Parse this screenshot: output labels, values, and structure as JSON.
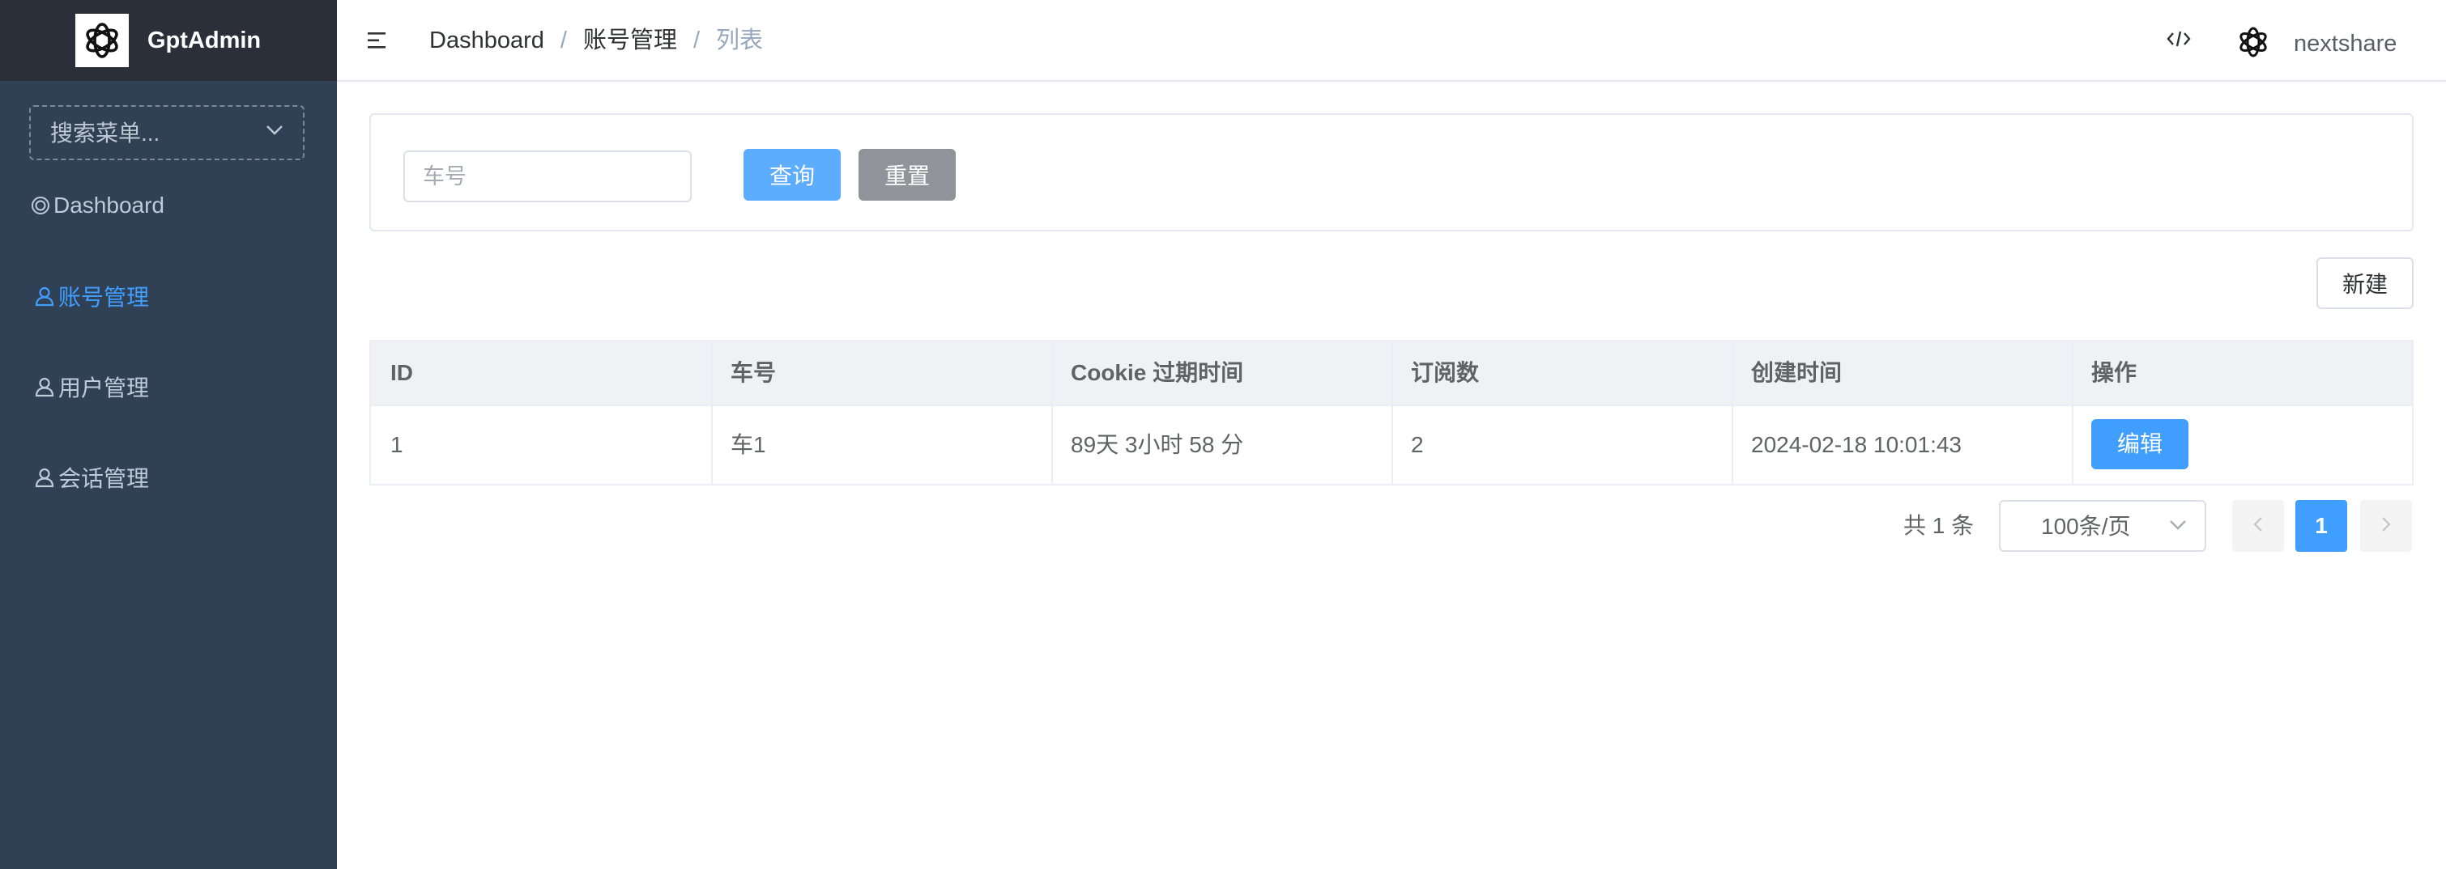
{
  "app": {
    "title": "GptAdmin"
  },
  "sidebar": {
    "search_placeholder": "搜索菜单...",
    "items": [
      {
        "label": "Dashboard",
        "icon": "target-icon",
        "active": false
      },
      {
        "label": "账号管理",
        "icon": "user-icon",
        "active": true
      },
      {
        "label": "用户管理",
        "icon": "user-icon",
        "active": false
      },
      {
        "label": "会话管理",
        "icon": "user-icon",
        "active": false
      }
    ]
  },
  "header": {
    "breadcrumb": [
      "Dashboard",
      "账号管理",
      "列表"
    ],
    "separator": "/",
    "username": "nextshare"
  },
  "search": {
    "car_placeholder": "车号",
    "query_label": "查询",
    "reset_label": "重置"
  },
  "actions": {
    "new_label": "新建"
  },
  "table": {
    "columns": [
      "ID",
      "车号",
      "Cookie 过期时间",
      "订阅数",
      "创建时间",
      "操作"
    ],
    "rows": [
      {
        "id": "1",
        "car": "车1",
        "expires": "89天 3小时 58 分",
        "subs": "2",
        "created": "2024-02-18 10:01:43",
        "action_label": "编辑"
      }
    ]
  },
  "pagination": {
    "total_text": "共 1 条",
    "page_size": "100条/页",
    "current_page": "1"
  },
  "colors": {
    "sidebar_bg": "#304156",
    "logo_bar_bg": "#2b2f3a",
    "primary": "#409eff",
    "reset_gray": "#909399"
  }
}
